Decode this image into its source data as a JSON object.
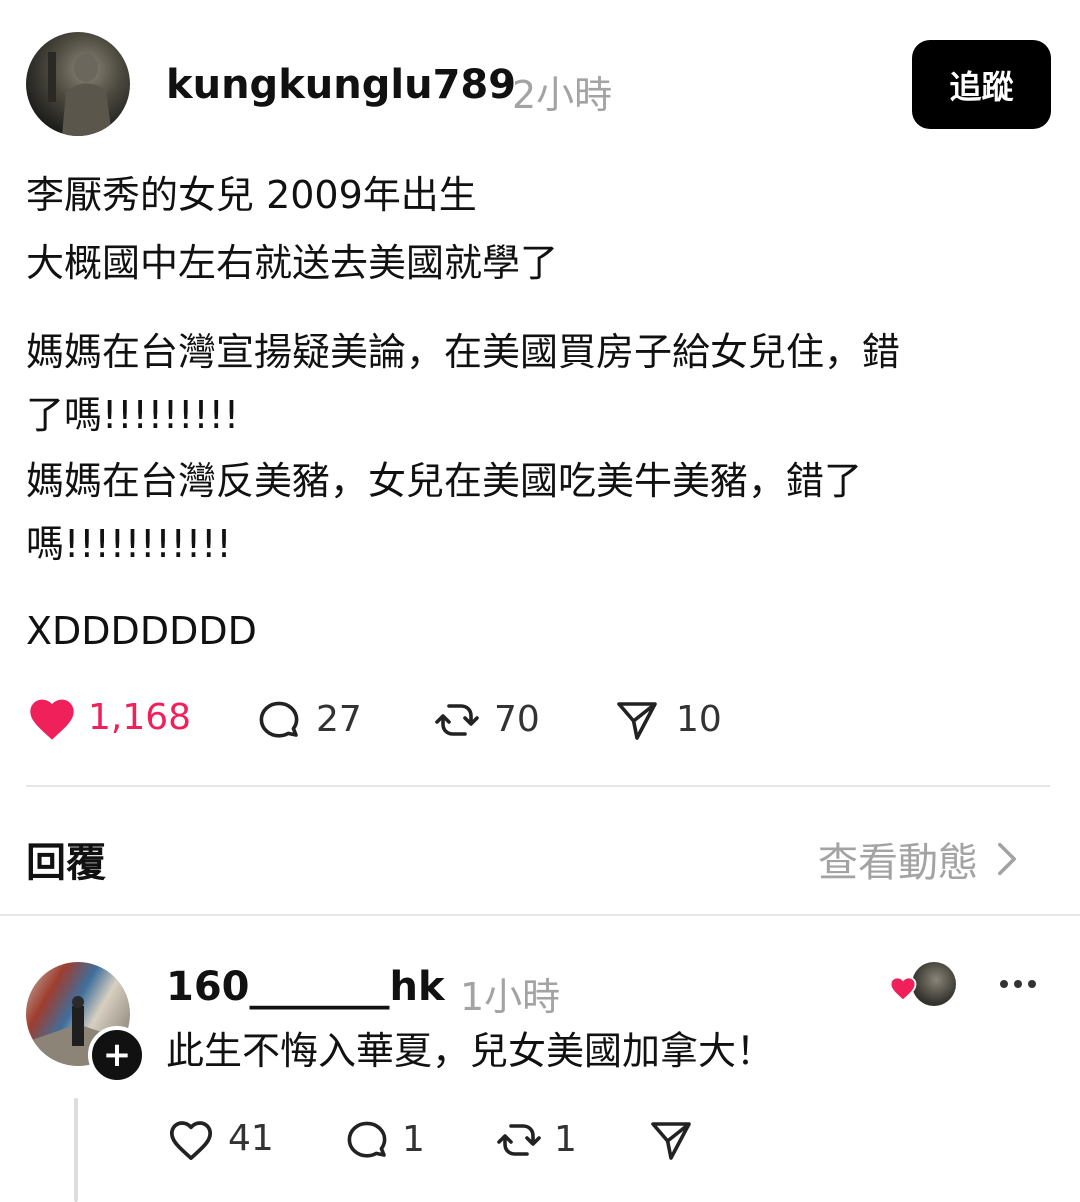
{
  "post": {
    "username": "kungkunglu789",
    "time": "2小時",
    "follow_label": "追蹤",
    "lines": [
      "李厭秀的女兒 2009年出生",
      "大概國中左右就送去美國就學了",
      "媽媽在台灣宣揚疑美論，在美國買房子給女兒住，錯",
      "了嗎!!!!!!!!!",
      "媽媽在台灣反美豬，女兒在美國吃美牛美豬，錯了",
      "嗎!!!!!!!!!!!",
      "XDDDDDDD"
    ],
    "stats": {
      "likes": "1,168",
      "comments": "27",
      "reposts": "70",
      "shares": "10"
    },
    "liked": true
  },
  "replies_header": {
    "label": "回覆",
    "view_activity": "查看動態"
  },
  "reply": {
    "username": "160_______hk",
    "time": "1小時",
    "text": "此生不悔入華夏，兒女美國加拿大！",
    "stats": {
      "likes": "41",
      "comments": "1",
      "reposts": "1"
    }
  },
  "icons": {
    "heart": "heart-icon",
    "comment": "comment-icon",
    "repost": "repost-icon",
    "share": "send-icon",
    "chevron": "chevron-right-icon",
    "more": "more-icon",
    "plus": "plus-icon"
  },
  "colors": {
    "like": "#f0205a",
    "muted": "#a3a3a3",
    "button_bg": "#000000"
  }
}
